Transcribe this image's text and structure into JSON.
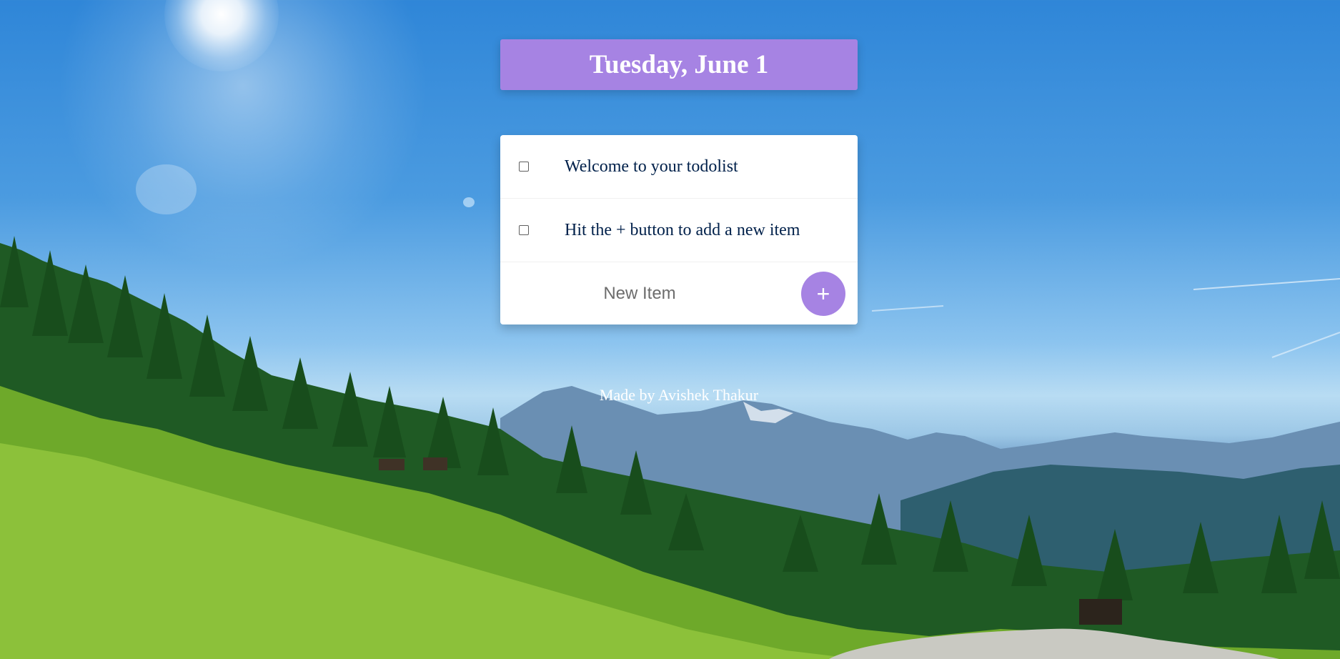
{
  "header": {
    "date": "Tuesday, June 1"
  },
  "todo": {
    "items": [
      {
        "text": "Welcome to your todolist",
        "checked": false
      },
      {
        "text": "Hit the + button to add a new item",
        "checked": false
      }
    ],
    "new_item_placeholder": "New Item",
    "add_button_label": "+"
  },
  "footer": {
    "text": "Made by Avishek Thakur"
  },
  "colors": {
    "accent": "#a683e3",
    "item_text": "#00204a"
  }
}
